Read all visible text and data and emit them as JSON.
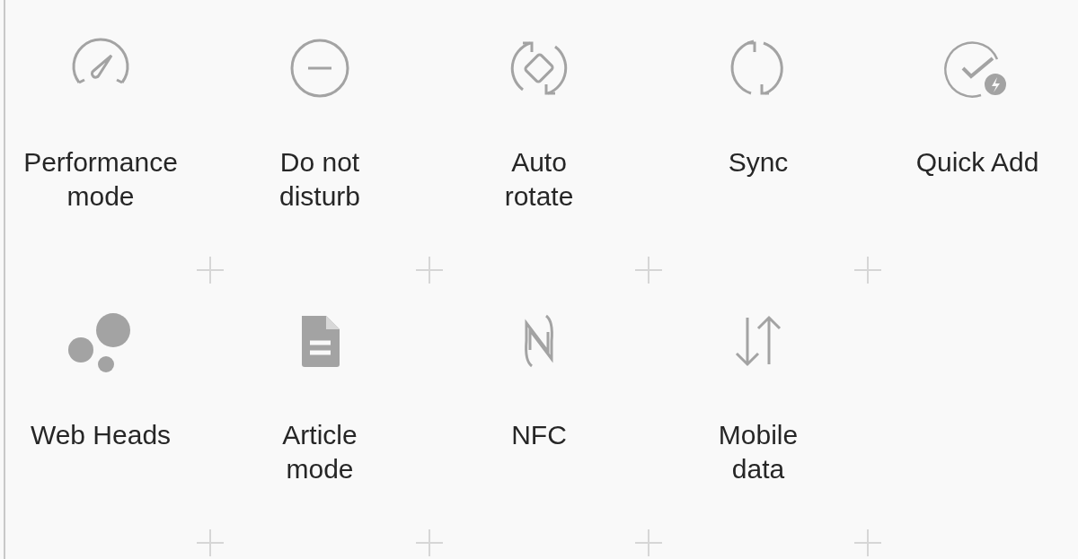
{
  "tiles_rows": [
    {
      "tiles": [
        {
          "kind": "gauge",
          "label": [
            "Performance",
            "mode"
          ]
        },
        {
          "kind": "minus-circle",
          "label": [
            "Do not",
            "disturb"
          ]
        },
        {
          "kind": "rotate",
          "label": [
            "Auto",
            "rotate"
          ]
        },
        {
          "kind": "sync",
          "label": [
            "Sync"
          ]
        },
        {
          "kind": "check-bolt",
          "label": [
            "Quick Add"
          ]
        }
      ]
    },
    {
      "tiles": [
        {
          "kind": "bubbles",
          "label": [
            "Web Heads"
          ]
        },
        {
          "kind": "document",
          "label": [
            "Article",
            "mode"
          ]
        },
        {
          "kind": "nfc",
          "label": [
            "NFC"
          ]
        },
        {
          "kind": "arrows",
          "label": [
            "Mobile",
            "data"
          ]
        }
      ]
    }
  ]
}
